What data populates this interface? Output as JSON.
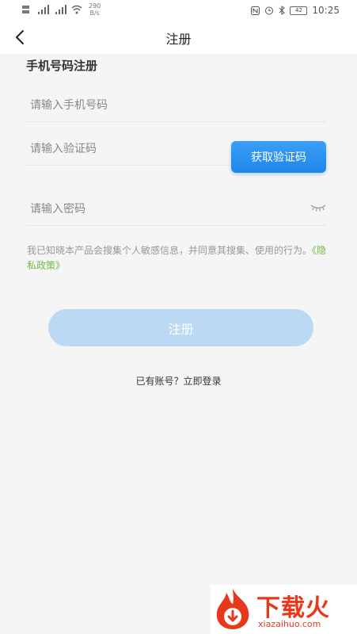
{
  "status_bar": {
    "net_speed_value": "290",
    "net_speed_unit": "B/s",
    "battery": "42",
    "time": "10:25"
  },
  "nav": {
    "title": "注册"
  },
  "form": {
    "section_title": "手机号码注册",
    "phone_placeholder": "请输入手机号码",
    "code_placeholder": "请输入验证码",
    "get_code_label": "获取验证码",
    "password_placeholder": "请输入密码"
  },
  "notice": {
    "text": "我已知晓本产品会搜集个人敏感信息，并同意其搜集、使用的行为。",
    "policy_link": "《隐私政策》"
  },
  "register_label": "注册",
  "login_link": "已有账号？立即登录",
  "watermark": {
    "title": "下载火",
    "subtitle": "xiazaihuo.com"
  },
  "colors": {
    "accent": "#1f86ea",
    "register_disabled": "#bcd9f3",
    "policy_link": "#6cbe45",
    "watermark": "#e8381c"
  }
}
